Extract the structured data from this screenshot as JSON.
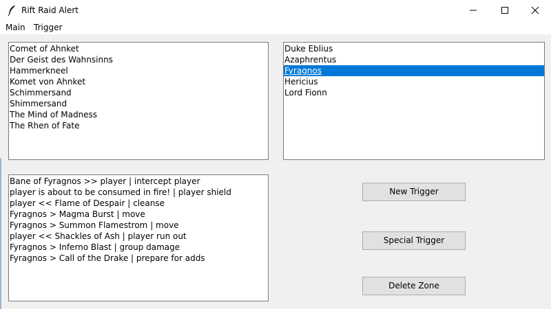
{
  "window": {
    "title": "Rift Raid Alert",
    "minimize": "Minimize",
    "maximize": "Maximize",
    "close": "Close"
  },
  "menu": {
    "main": "Main",
    "trigger": "Trigger"
  },
  "zones": {
    "items": [
      "Comet of Ahnket",
      "Der Geist des Wahnsinns",
      "Hammerkneel",
      "Komet von Ahnket",
      "Schimmersand",
      "Shimmersand",
      "The Mind of Madness",
      "The Rhen of Fate"
    ]
  },
  "bosses": {
    "items": [
      "Duke Eblius",
      "Azaphrentus",
      "Fyragnos",
      "Hericius",
      "Lord Fionn"
    ],
    "selected": "Fyragnos",
    "selected_color": "#0078d7"
  },
  "triggers": {
    "items": [
      "Bane of Fyragnos >> player | intercept player",
      "player is about to be consumed in fire! | player shield",
      "player << Flame of Despair | cleanse",
      "Fyragnos > Magma Burst | move",
      "Fyragnos > Summon Flamestrom | move",
      "player << Shackles of Ash | player run out",
      "Fyragnos > Inferno Blast | group damage",
      "Fyragnos > Call of the Drake | prepare for adds"
    ]
  },
  "buttons": {
    "new_trigger": "New Trigger",
    "special_trigger": "Special Trigger",
    "delete_zone": "Delete Zone"
  }
}
